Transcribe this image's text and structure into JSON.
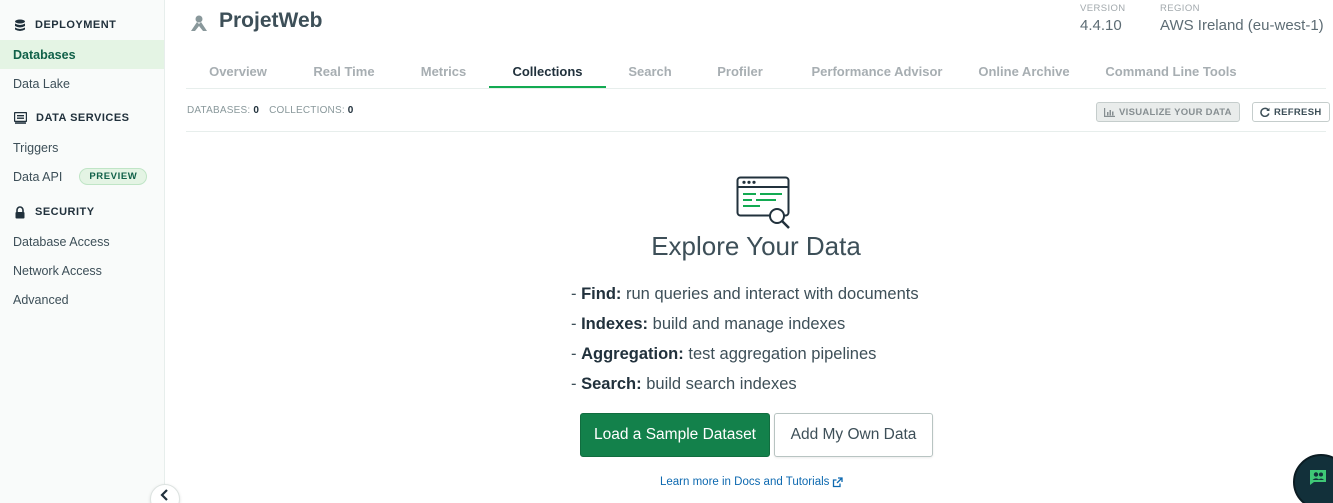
{
  "sidebar": {
    "sections": [
      {
        "title": "DEPLOYMENT",
        "icon": "database-icon",
        "items": [
          {
            "label": "Databases",
            "active": true
          },
          {
            "label": "Data Lake",
            "active": false
          }
        ]
      },
      {
        "title": "DATA SERVICES",
        "icon": "data-services-icon",
        "items": [
          {
            "label": "Triggers",
            "active": false
          },
          {
            "label": "Data API",
            "active": false,
            "badge": "PREVIEW"
          }
        ]
      },
      {
        "title": "SECURITY",
        "icon": "lock-icon",
        "items": [
          {
            "label": "Database Access",
            "active": false
          },
          {
            "label": "Network Access",
            "active": false
          },
          {
            "label": "Advanced",
            "active": false
          }
        ]
      }
    ]
  },
  "header": {
    "cluster_name": "ProjetWeb",
    "version_label": "VERSION",
    "version_value": "4.4.10",
    "region_label": "REGION",
    "region_value": "AWS Ireland (eu-west-1)"
  },
  "tabs": [
    {
      "label": "Overview",
      "active": false
    },
    {
      "label": "Real Time",
      "active": false
    },
    {
      "label": "Metrics",
      "active": false
    },
    {
      "label": "Collections",
      "active": true
    },
    {
      "label": "Search",
      "active": false
    },
    {
      "label": "Profiler",
      "active": false
    },
    {
      "label": "Performance Advisor",
      "active": false
    },
    {
      "label": "Online Archive",
      "active": false
    },
    {
      "label": "Command Line Tools",
      "active": false
    }
  ],
  "stats": {
    "databases_label": "DATABASES:",
    "databases_value": "0",
    "collections_label": "COLLECTIONS:",
    "collections_value": "0"
  },
  "toolbar": {
    "visualize_label": "VISUALIZE YOUR DATA",
    "refresh_label": "REFRESH"
  },
  "empty_state": {
    "title": "Explore Your Data",
    "features": [
      {
        "name": "Find:",
        "desc": "run queries and interact with documents"
      },
      {
        "name": "Indexes:",
        "desc": "build and manage indexes"
      },
      {
        "name": "Aggregation:",
        "desc": "test aggregation pipelines"
      },
      {
        "name": "Search:",
        "desc": "build search indexes"
      }
    ],
    "load_sample_label": "Load a Sample Dataset",
    "add_own_label": "Add My Own Data",
    "learn_more_label": "Learn more in Docs and Tutorials"
  },
  "colors": {
    "accent": "#13aa52",
    "primary_button": "#13814b",
    "link": "#0d69b0",
    "sidebar_active_bg": "#e4f4e4"
  }
}
